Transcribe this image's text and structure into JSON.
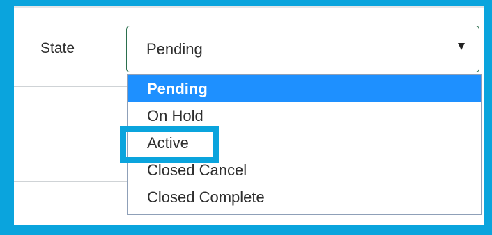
{
  "form": {
    "state_label": "State",
    "state_select": {
      "value": "Pending",
      "options": [
        "Pending",
        "On Hold",
        "Active",
        "Closed Cancel",
        "Closed Complete"
      ],
      "selected_index": 0,
      "highlighted_option": "Active"
    }
  },
  "colors": {
    "frame_border": "#0aa4dd",
    "select_border": "#2b6f4d",
    "selected_option_bg": "#1e90ff",
    "annotation_highlight": "#0aa4dd"
  },
  "icons": {
    "select_arrow": "caret-down-icon"
  }
}
